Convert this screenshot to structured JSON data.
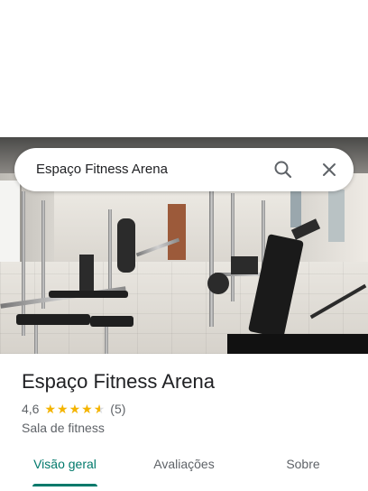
{
  "search": {
    "query": "Espaço Fitness Arena",
    "search_icon": "search-icon",
    "close_icon": "close-icon"
  },
  "place": {
    "title": "Espaço Fitness Arena",
    "rating": "4,6",
    "stars_filled": 4.6,
    "reviews": "(5)",
    "category": "Sala de fitness"
  },
  "tabs": [
    {
      "label": "Visão geral",
      "active": true
    },
    {
      "label": "Avaliações",
      "active": false
    },
    {
      "label": "Sobre",
      "active": false
    }
  ],
  "colors": {
    "accent": "#00796b",
    "star": "#f4b400",
    "text_primary": "#202124",
    "text_secondary": "#5f6368"
  }
}
